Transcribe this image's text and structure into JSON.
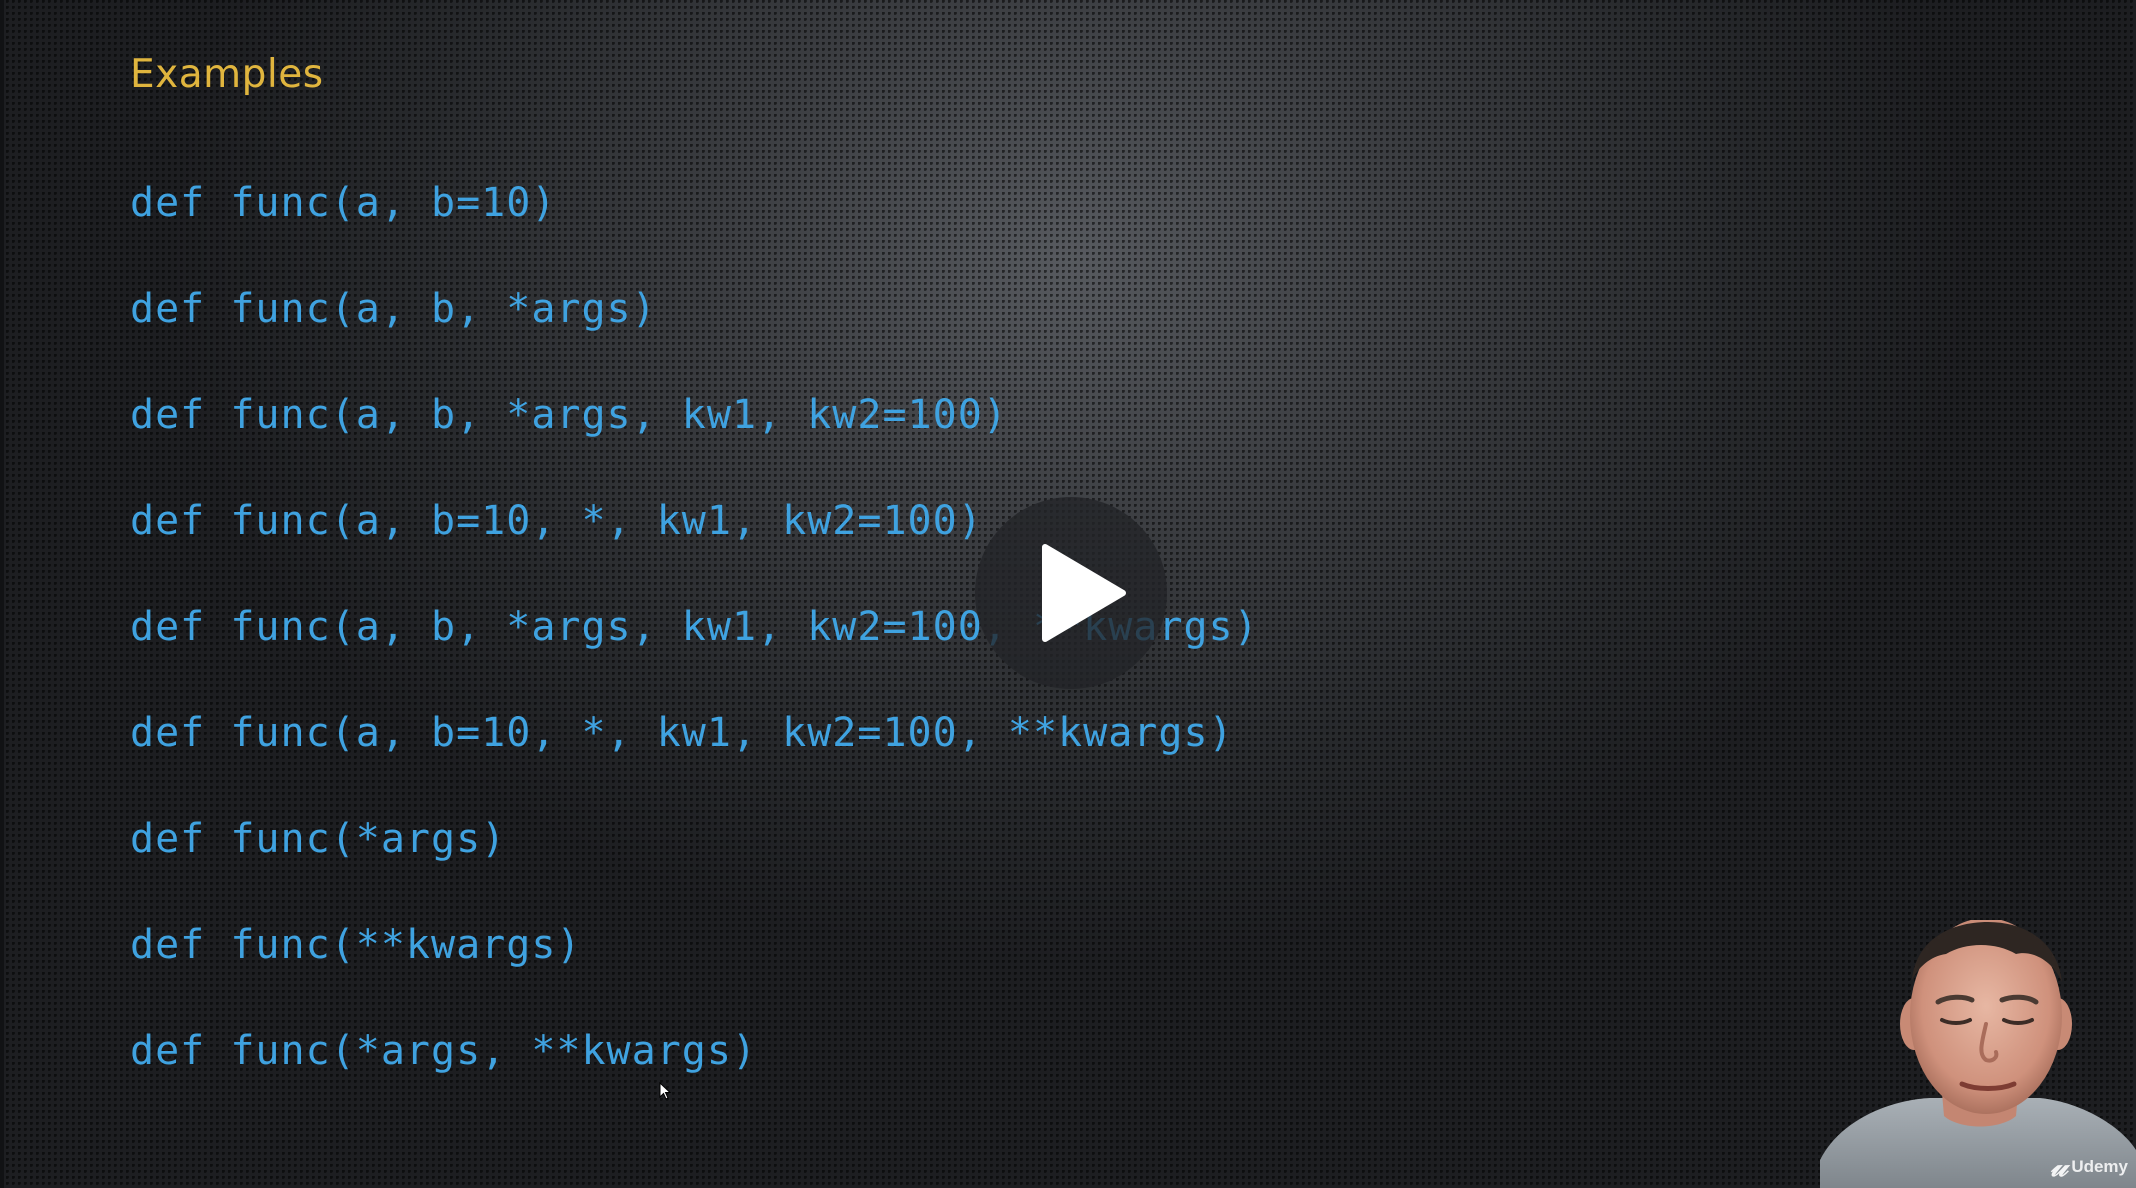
{
  "slide": {
    "title": "Examples",
    "code_lines": [
      "def func(a, b=10)",
      "def func(a, b, *args)",
      "def func(a, b, *args, kw1, kw2=100)",
      "def func(a, b=10, *, kw1, kw2=100)",
      "def func(a, b, *args, kw1, kw2=100, **kwargs)",
      "def func(a, b=10, *, kw1, kw2=100, **kwargs)",
      "def func(*args)",
      "def func(**kwargs)",
      "def func(*args, **kwargs)"
    ]
  },
  "player": {
    "play_icon": "play-icon",
    "watermark": "Udemy",
    "watermark_icon": "udemy-logo-icon"
  },
  "colors": {
    "title": "#e0b53e",
    "code": "#3fa2e0",
    "background": "#2b2d30"
  }
}
